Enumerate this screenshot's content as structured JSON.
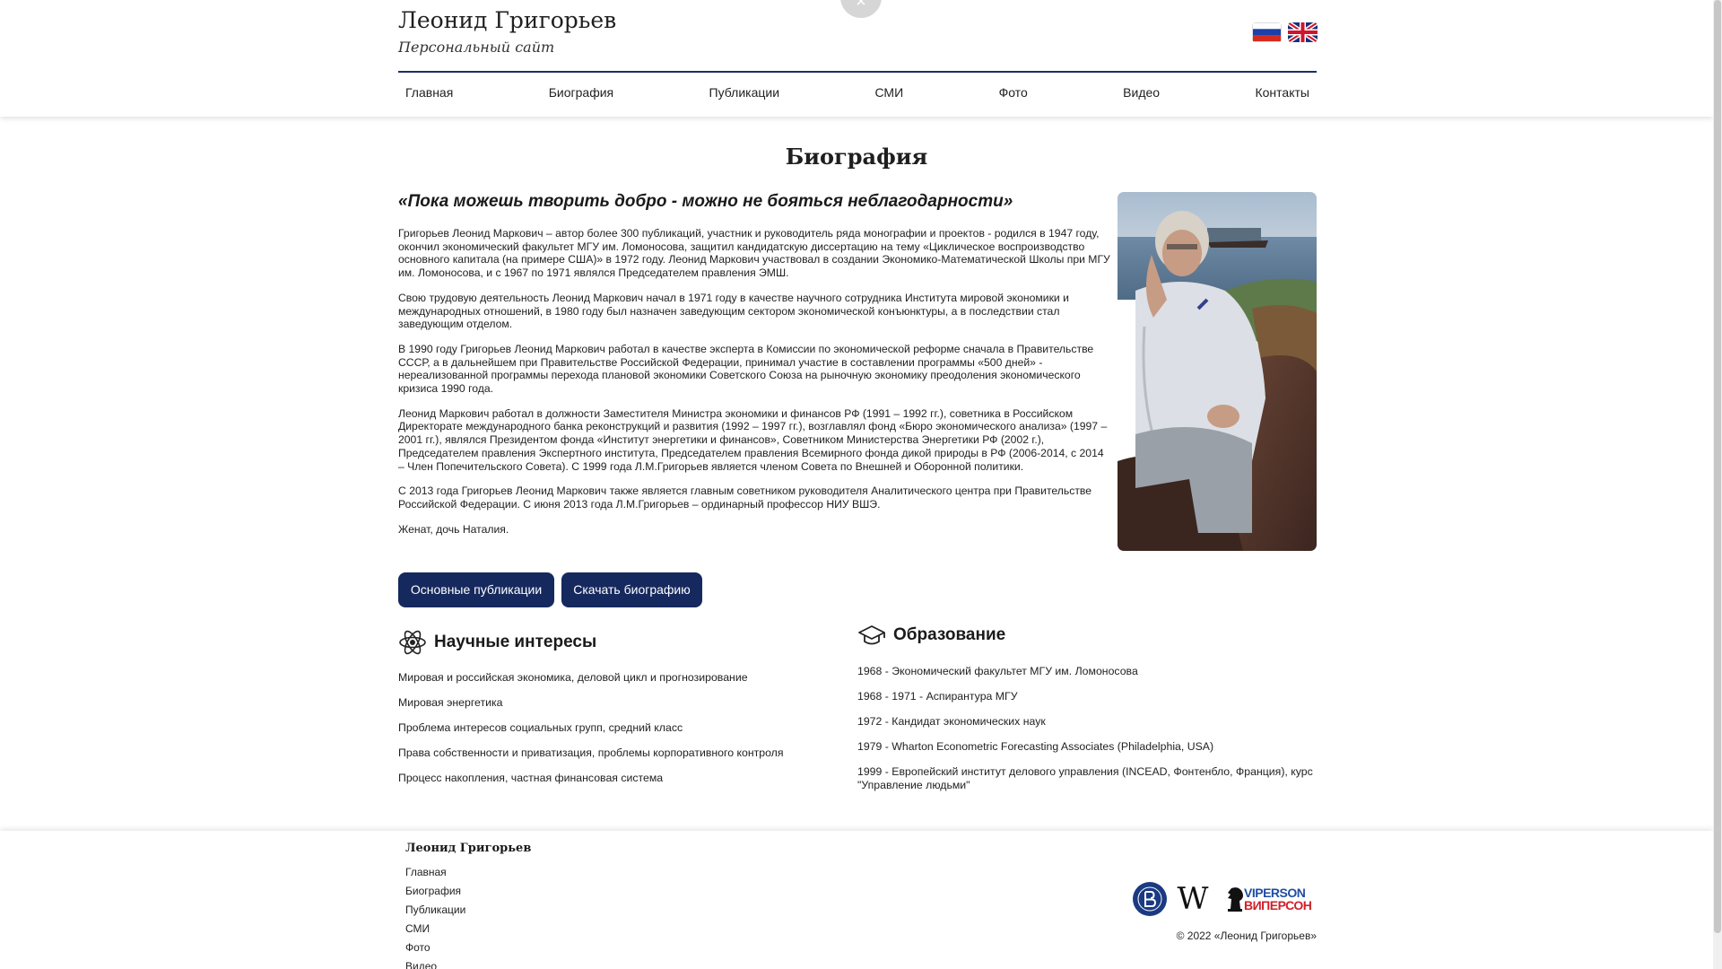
{
  "header": {
    "site_title": "Леонид Григорьев",
    "site_subtitle": "Персональный сайт",
    "close_glyph": "×"
  },
  "nav": {
    "items": [
      "Главная",
      "Биография",
      "Публикации",
      "СМИ",
      "Фото",
      "Видео",
      "Контакты"
    ]
  },
  "page": {
    "heading": "Биография",
    "quote": "«Пока можешь творить добро - можно не бояться неблагодарности»",
    "paragraphs": [
      "Григорьев Леонид Маркович – автор более 300 публикаций, участник и руководитель ряда монографии и проектов - родился в 1947 году, окончил экономический факультет МГУ им. Ломоносова, защитил кандидатскую диссертацию на тему «Циклическое воспроизводство основного капитала (на примере США)» в 1972 году. Леонид Маркович участвовал в создании Экономико-Математической Школы при МГУ им. Ломоносова, и с 1967 по 1971 являлся Председателем правления ЭМШ.",
      "Свою трудовую деятельность Леонид Маркович начал в 1971 году в качестве научного сотрудника Института мировой экономики и международных отношений, в 1980 году был назначен заведующим сектором экономической конъюнктуры, а в последствии стал заведующим отделом.",
      "В 1990 году Григорьев Леонид Маркович работал в качестве эксперта в Комиссии по экономической реформе сначала в Правительстве СССР, а в дальнейшем при Правительстве Российской Федерации, принимал участие в составлении программы «500 дней» - нереализованной программы перехода плановой экономики Советского Союза на рыночную экономику преодоления экономического кризиса 1990 года.",
      "Леонид Маркович работал в должности Заместителя Министра экономики и финансов РФ (1991 – 1992 гг.), советника в Российском Директорате международного банка реконструкций и развития (1992 – 1997 гг.), возглавлял фонд «Бюро экономического анализа» (1997 – 2001 гг.), являлся Президентом фонда «Институт энергетики и финансов», Советником Министерства Энергетики РФ (2002 г.), Председателем правления Экспертного института, Председателем правления Всемирного фонда дикой природы в РФ (2006-2014, с 2014 – Член Попечительского Совета). С 1999 года Л.М.Григорьев является членом Совета по Внешней и Оборонной политики.",
      "С 2013 года Григорьев Леонид Маркович также является главным советником руководителя Аналитического центра при Правительстве Российской Федерации. С июня 2013 года Л.М.Григорьев – ординарный профессор НИУ ВШЭ.",
      "Женат, дочь Наталия."
    ],
    "buttons": {
      "publications": "Основные публикации",
      "download": "Скачать биографию"
    }
  },
  "interests": {
    "title": "Научные интересы",
    "items": [
      "Мировая и российская экономика, деловой цикл и прогнозирование",
      "Мировая энергетика",
      "Проблема интересов социальных групп, средний класс",
      "Права собственности и приватизация, проблемы корпоративного контроля",
      "Процесс накопления, частная финансовая система"
    ]
  },
  "education": {
    "title": "Образование",
    "items": [
      "1968 - Экономический факультет МГУ им. Ломоносова",
      "1968 - 1971 - Аспирантура МГУ",
      "1972 - Кандидат экономических наук",
      "1979 - Wharton Econometric Forecasting Associates (Philadelphia, USA)",
      "1999 - Европейский институт делового управления (INCEAD, Фонтенбло, Франция), курс \"Управление людьми\""
    ]
  },
  "footer": {
    "title": "Леонид Григорьев",
    "links": [
      "Главная",
      "Биография",
      "Публикации",
      "СМИ",
      "Фото",
      "Видео"
    ],
    "logos": {
      "wiki": "W",
      "viperson_en": "VIPERSON",
      "viperson_ru": "ВИПЕРСОН"
    },
    "copyright": "© 2022 «Леонид Григорьев»"
  },
  "colors": {
    "accent_navy": "#16295e",
    "viperson_blue": "#1f4ea3",
    "viperson_red": "#d0202a"
  }
}
